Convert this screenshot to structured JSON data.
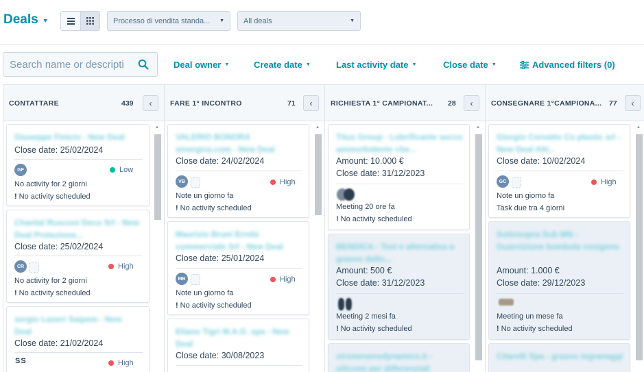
{
  "header": {
    "title": "Deals",
    "pipeline_select": "Processo di vendita standa...",
    "view_select": "All deals"
  },
  "filters": {
    "search_placeholder": "Search name or descripti",
    "deal_owner": "Deal owner",
    "create_date": "Create date",
    "last_activity_date": "Last activity date",
    "close_date": "Close date",
    "advanced": "Advanced filters (0)"
  },
  "colors": {
    "accent": "#0091ae",
    "high": "#f2545b",
    "low": "#00bda5",
    "text": "#33475b"
  },
  "columns": [
    {
      "name": "CONTATTARE",
      "count": "439",
      "cards": [
        {
          "title": "Giuseppe Finicio - New Deal",
          "lines": [
            "Close date: 25/02/2024"
          ],
          "avatar": "GF",
          "priority": "Low",
          "activity": "No activity for 2 giorni",
          "schedule": "No activity scheduled"
        },
        {
          "title": "Chantal Rusconi Deco Srl - New Deal Protezione...",
          "lines": [
            "Close date: 25/02/2024"
          ],
          "avatar": "CR",
          "priority": "High",
          "activity": "No activity for 2 giorni",
          "schedule": "No activity scheduled"
        },
        {
          "title": "sergio Laneri Saipem - New Deal",
          "lines": [
            "Close date: 21/02/2024"
          ],
          "avatar": "SS",
          "priority": "High"
        }
      ]
    },
    {
      "name": "FARE 1° INCONTRO",
      "count": "71",
      "cards": [
        {
          "title": "VALERIO BONORA sinergica.com - New Deal",
          "lines": [
            "Close date: 24/02/2024"
          ],
          "avatar": "VB",
          "priority": "High",
          "activity": "Note un giorno fa",
          "schedule": "No activity scheduled"
        },
        {
          "title": "Maurizio Bruni Errebi commerciale Srl - New Deal",
          "lines": [
            "Close date: 25/01/2024"
          ],
          "avatar": "MB",
          "priority": "High",
          "activity": "Note un giorno fa",
          "schedule": "No activity scheduled"
        },
        {
          "title": "Eliano Tigri M.A.G. spa - New Deal",
          "lines": [
            "Close date: 30/08/2023"
          ]
        }
      ]
    },
    {
      "name": "RICHIESTA 1° CAMPIONAT...",
      "count": "28",
      "cards": [
        {
          "title": "Titus Group - Lubrificante secco ammorbidente che...",
          "lines": [
            "Amount: 10.000 €",
            "Close date: 31/12/2023"
          ],
          "activity": "Meeting 20 ore fa",
          "schedule": "No activity scheduled"
        },
        {
          "title": "BENDICA - Test e alternativa a grasso dello...",
          "lines": [
            "Amount: 500 €",
            "Close date: 31/12/2023"
          ],
          "activity": "Meeting 2 mesi fa",
          "schedule": "No activity scheduled"
        },
        {
          "title": "xtremesensdynamics.it - silicone per differenziali"
        }
      ]
    },
    {
      "name": "CONSEGNARE 1°CAMPIONA...",
      "count": "77",
      "cards": [
        {
          "title": "Giorgio Corvatto Cs plastic srl - New Deal Alti...",
          "lines": [
            "Close date: 10/02/2024"
          ],
          "avatar": "GC",
          "priority": "High",
          "activity": "Note un giorno fa",
          "schedule": "Task due tra 4 giorni"
        },
        {
          "title": "Sottosopra Sub MN - Guarnizione bombola ossigeno",
          "lines": [
            "Amount: 1.000 €",
            "Close date: 29/12/2023"
          ],
          "activity": "Meeting un mese fa",
          "schedule": "No activity scheduled"
        },
        {
          "title": "Citarelli Spa - grasso ingranaggi"
        }
      ]
    }
  ]
}
